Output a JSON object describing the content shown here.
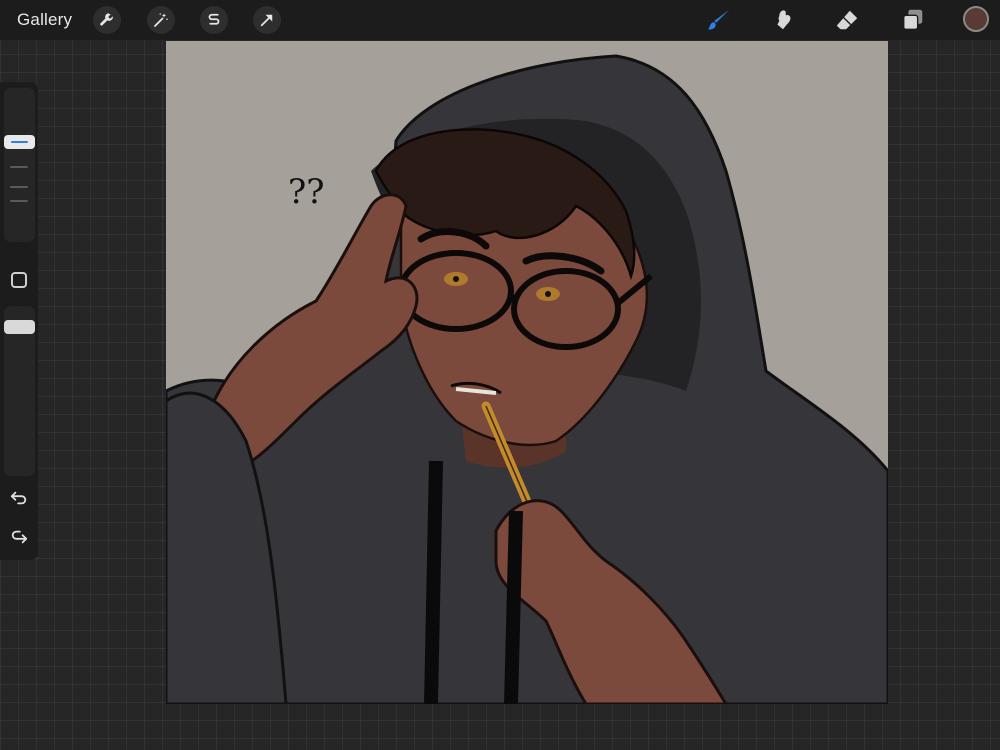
{
  "topbar": {
    "gallery_label": "Gallery",
    "left_tools": [
      "wrench-icon",
      "magic-wand-icon",
      "selection-s-icon",
      "transform-arrow-icon"
    ],
    "right_tools": [
      "brush-icon",
      "smudge-icon",
      "eraser-icon",
      "layers-icon"
    ],
    "active_tool": "brush-icon",
    "current_color": "#5a3a34"
  },
  "sidebar": {
    "size_slider_icon": "size-slider",
    "modify_button_icon": "square-icon",
    "opacity_slider_icon": "opacity-slider",
    "undo_icon": "undo-icon",
    "redo_icon": "redo-icon"
  },
  "canvas": {
    "background_color": "#a5a09a",
    "artwork_text": "??"
  },
  "colors": {
    "accent_blue": "#2f7fe6",
    "toolbar_bg": "#1c1c1c",
    "workspace_bg": "#262626",
    "hoodie": "#3a3a3e",
    "skin": "#7b4a3c"
  }
}
